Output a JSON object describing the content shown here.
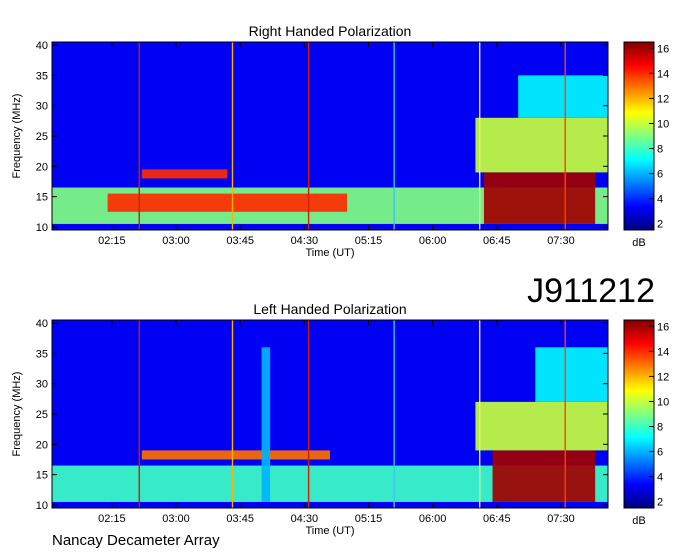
{
  "figure": {
    "observation_id": "J911212",
    "instrument_label": "Nancay Decameter Array",
    "palette": [
      "#00007f",
      "#0000ff",
      "#0080ff",
      "#00ffff",
      "#80ff80",
      "#ffff00",
      "#ff8000",
      "#ff0000",
      "#7f0000"
    ]
  },
  "chart_data": [
    {
      "type": "heatmap",
      "title": "Right Handed Polarization",
      "xlabel": "Time (UT)",
      "ylabel": "Frequency (MHz)",
      "x_tick_labels": [
        "02:15",
        "03:00",
        "03:45",
        "04:30",
        "05:15",
        "06:00",
        "06:45",
        "07:30"
      ],
      "x_ticks_hours": [
        2.25,
        3.0,
        3.75,
        4.5,
        5.25,
        6.0,
        6.75,
        7.5
      ],
      "xlim_hours": [
        1.55,
        8.05
      ],
      "ylim": [
        9.5,
        40.5
      ],
      "y_ticks": [
        10,
        15,
        20,
        25,
        30,
        35,
        40
      ],
      "y_tick_labels": [
        "10",
        "15",
        "20",
        "25",
        "30",
        "35",
        "40"
      ],
      "colorbar": {
        "label": "dB",
        "range": [
          1.5,
          16.5
        ],
        "ticks": [
          2,
          4,
          6,
          8,
          10,
          12,
          14,
          16
        ],
        "tick_labels": [
          "2",
          "4",
          "6",
          "8",
          "10",
          "12",
          "14",
          "16"
        ]
      },
      "time_markers_hours": [
        {
          "t": 2.57,
          "color": "#cc2000"
        },
        {
          "t": 3.66,
          "color": "#ffb000"
        },
        {
          "t": 4.55,
          "color": "#cc2000"
        },
        {
          "t": 5.55,
          "color": "#40c0ff"
        },
        {
          "t": 6.55,
          "color": "#f0f080"
        },
        {
          "t": 7.55,
          "color": "#ff4000"
        }
      ],
      "emission_regions": [
        {
          "t_start": 1.55,
          "t_end": 8.05,
          "f_low": 10.5,
          "f_high": 16.5,
          "level": 9
        },
        {
          "t_start": 2.2,
          "t_end": 5.0,
          "f_low": 12.5,
          "f_high": 15.5,
          "level": 14
        },
        {
          "t_start": 2.6,
          "t_end": 3.6,
          "f_low": 18.0,
          "f_high": 19.5,
          "level": 14
        },
        {
          "t_start": 6.6,
          "t_end": 7.9,
          "f_low": 10.5,
          "f_high": 19.0,
          "level": 16
        },
        {
          "t_start": 6.5,
          "t_end": 8.05,
          "f_low": 19.0,
          "f_high": 28.0,
          "level": 10
        },
        {
          "t_start": 7.0,
          "t_end": 8.05,
          "f_low": 28.0,
          "f_high": 35.0,
          "level": 7
        }
      ]
    },
    {
      "type": "heatmap",
      "title": "Left Handed Polarization",
      "xlabel": "Time (UT)",
      "ylabel": "Frequency (MHz)",
      "x_tick_labels": [
        "02:15",
        "03:00",
        "03:45",
        "04:30",
        "05:15",
        "06:00",
        "06:45",
        "07:30"
      ],
      "x_ticks_hours": [
        2.25,
        3.0,
        3.75,
        4.5,
        5.25,
        6.0,
        6.75,
        7.5
      ],
      "xlim_hours": [
        1.55,
        8.05
      ],
      "ylim": [
        9.5,
        40.5
      ],
      "y_ticks": [
        10,
        15,
        20,
        25,
        30,
        35,
        40
      ],
      "y_tick_labels": [
        "10",
        "15",
        "20",
        "25",
        "30",
        "35",
        "40"
      ],
      "colorbar": {
        "label": "dB",
        "range": [
          1.5,
          16.5
        ],
        "ticks": [
          2,
          4,
          6,
          8,
          10,
          12,
          14,
          16
        ],
        "tick_labels": [
          "2",
          "4",
          "6",
          "8",
          "10",
          "12",
          "14",
          "16"
        ]
      },
      "time_markers_hours": [
        {
          "t": 2.57,
          "color": "#cc2000"
        },
        {
          "t": 3.66,
          "color": "#ffb000"
        },
        {
          "t": 4.55,
          "color": "#cc2000"
        },
        {
          "t": 5.55,
          "color": "#40c0ff"
        },
        {
          "t": 6.55,
          "color": "#f0f080"
        },
        {
          "t": 7.55,
          "color": "#ff4000"
        }
      ],
      "emission_regions": [
        {
          "t_start": 1.55,
          "t_end": 8.05,
          "f_low": 10.5,
          "f_high": 16.5,
          "level": 8
        },
        {
          "t_start": 2.6,
          "t_end": 4.8,
          "f_low": 17.5,
          "f_high": 19.0,
          "level": 13
        },
        {
          "t_start": 4.0,
          "t_end": 4.1,
          "f_low": 10.5,
          "f_high": 36.0,
          "level": 6
        },
        {
          "t_start": 6.7,
          "t_end": 7.9,
          "f_low": 10.5,
          "f_high": 19.0,
          "level": 16
        },
        {
          "t_start": 6.5,
          "t_end": 8.05,
          "f_low": 19.0,
          "f_high": 27.0,
          "level": 10
        },
        {
          "t_start": 7.2,
          "t_end": 8.05,
          "f_low": 27.0,
          "f_high": 36.0,
          "level": 7
        }
      ]
    }
  ]
}
